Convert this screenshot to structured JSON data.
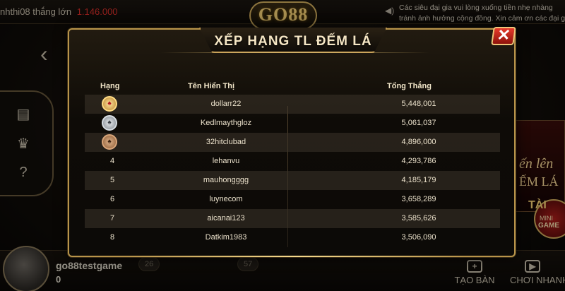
{
  "ticker": {
    "user": "nhthi08",
    "won_label": "thắng lớn",
    "amount": "1.146.000"
  },
  "logo": "GO88",
  "notice": {
    "line1": "Các siêu đại gia vui lòng xuống tiền nhẹ nhàng",
    "line2": "tránh ảnh hưởng cộng đồng. Xin cảm ơn các đại gia"
  },
  "modal": {
    "title": "XẾP HẠNG TL ĐẾM LÁ",
    "close_label": "✕",
    "headers": {
      "rank": "Hạng",
      "name": "Tên Hiển Thị",
      "total": "Tổng Thắng"
    },
    "rows": [
      {
        "rank": "1",
        "name": "dollarr22",
        "total": "5,448,001"
      },
      {
        "rank": "2",
        "name": "Kedlmaythglоz",
        "total": "5,061,037"
      },
      {
        "rank": "3",
        "name": "32hitclubad",
        "total": "4,896,000"
      },
      {
        "rank": "4",
        "name": "lehanvu",
        "total": "4,293,786"
      },
      {
        "rank": "5",
        "name": "mauhongggg",
        "total": "4,185,179"
      },
      {
        "rank": "6",
        "name": "luynecom",
        "total": "3,658,289"
      },
      {
        "rank": "7",
        "name": "aicanai123",
        "total": "3,585,626"
      },
      {
        "rank": "8",
        "name": "Datkim1983",
        "total": "3,506,090"
      }
    ]
  },
  "side_card": {
    "line1": "ến lên",
    "line2": "ẾM LÁ"
  },
  "mini_game": {
    "label1": "TÀI",
    "label2": "MINI",
    "label3": "GAME"
  },
  "player": {
    "name": "go88testgame",
    "balance": "0"
  },
  "pills": {
    "left": "26",
    "right": "57"
  },
  "buttons": {
    "create_table": "TẠO BÀN",
    "play_now": "CHƠI NHANH"
  },
  "icons": {
    "back": "chevron-left-icon",
    "notice": "speaker-icon",
    "side1": "document-icon",
    "side2": "trophy-icon",
    "side3": "help-icon",
    "medal1": "gold-medal-icon",
    "medal2": "silver-medal-icon",
    "medal3": "bronze-medal-icon"
  },
  "colors": {
    "accent_gold": "#c49b52",
    "close_red": "#e73a2b",
    "ticker_amount": "#e0312b"
  }
}
